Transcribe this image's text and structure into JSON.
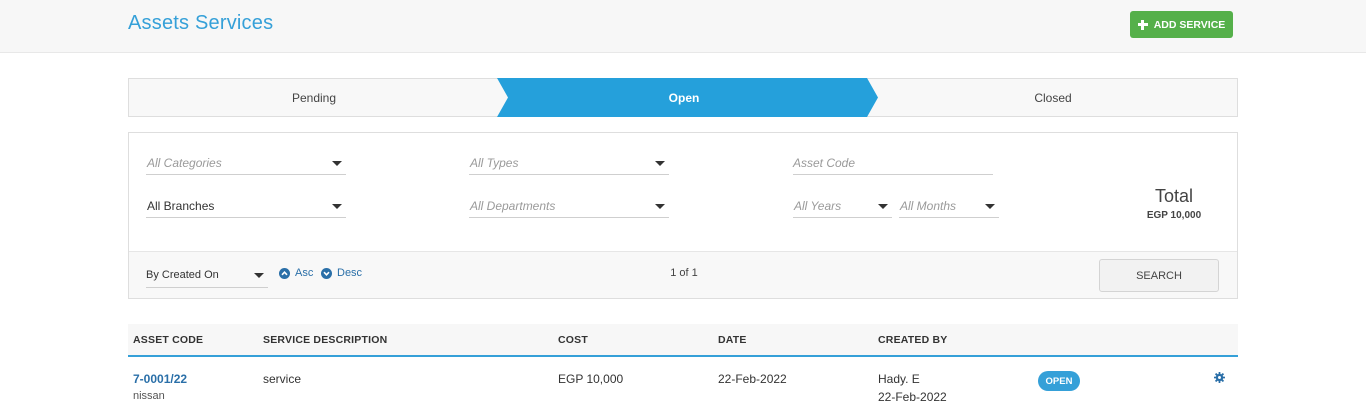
{
  "header": {
    "title": "Assets Services",
    "add_button_label": "ADD SERVICE"
  },
  "steps": [
    {
      "label": "Pending",
      "active": false
    },
    {
      "label": "Open",
      "active": true
    },
    {
      "label": "Closed",
      "active": false
    }
  ],
  "filters": {
    "categories_placeholder": "All Categories",
    "types_placeholder": "All Types",
    "asset_code_placeholder": "Asset Code",
    "branches_value": "All Branches",
    "departments_placeholder": "All Departments",
    "years_placeholder": "All Years",
    "months_placeholder": "All Months",
    "total_label": "Total",
    "total_value": "EGP 10,000"
  },
  "sort": {
    "by_value": "By Created On",
    "asc_label": "Asc",
    "desc_label": "Desc",
    "pager": "1 of 1",
    "search_label": "SEARCH"
  },
  "table": {
    "columns": [
      "ASSET CODE",
      "SERVICE DESCRIPTION",
      "COST",
      "DATE",
      "CREATED BY"
    ],
    "rows": [
      {
        "asset_code": "7-0001/22",
        "asset_name": "nissan",
        "description": "service",
        "cost": "EGP 10,000",
        "date": "22-Feb-2022",
        "created_by": "Hady. E",
        "created_date": "22-Feb-2022",
        "status": "OPEN",
        "action_icon": "gear-icon"
      }
    ]
  },
  "colors": {
    "accent": "#35a0d8",
    "add_button": "#55b04a",
    "link": "#2a6fa8"
  }
}
